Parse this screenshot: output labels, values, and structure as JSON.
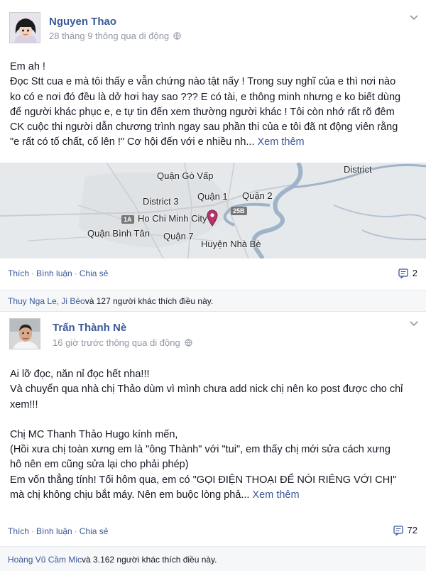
{
  "post1": {
    "author": "Nguyen Thao",
    "meta": "28 tháng 9 thông qua di động",
    "lines": [
      "Em ah !",
      "Đọc Stt cua e mà tôi thấy e vẫn chứng nào tật nấy ! Trong suy nghĩ của e thì nơi nào",
      "ko có e nơi đó đều là dở hơi hay sao ??? E có tài, e thông minh nhưng e ko biết dùng",
      "để người khác phục e, e tự tin đến xem thường người khác ! Tôi còn nhớ rất rõ đêm",
      "CK cuộc thi người dẫn chương trình ngay sau phần thi của e tôi đã nt động viên rằng",
      "\"e rất có tố chất, cố lên !\" Cơ hội đến với e nhiều nh..."
    ],
    "see_more": "Xem thêm",
    "map": {
      "labels": {
        "district": "District",
        "go_vap": "Quận Gò Vấp",
        "district3": "District 3",
        "q1": "Quận 1",
        "q2": "Quận 2",
        "hcmc": "Ho Chi Minh City",
        "binh_tan": "Quận Bình Tân",
        "q7": "Quận 7",
        "nha_be": "Huyện Nhà Bè",
        "shield_1a": "1A",
        "shield_25b": "25B"
      }
    },
    "actions": {
      "like": "Thích",
      "comment": "Bình luận",
      "share": "Chia sẻ"
    },
    "comment_count": "2",
    "likes": {
      "names": "Thuy Nga Le, Ji Béo",
      "rest": " và 127 người khác thích điều này."
    }
  },
  "post2": {
    "author": "Trấn Thành Nè",
    "meta": "16 giờ trước thông qua di động",
    "lines": [
      "Ai lỡ đọc, năn nỉ đọc hết nha!!!",
      "Và chuyển qua nhà chị Thảo dùm vì mình chưa add nick chị nên ko post được cho chỉ",
      "xem!!!",
      "",
      "Chị MC Thanh Thảo Hugo kính mến,",
      "(Hồi xưa chị toàn xưng em là \"ông Thành\" với \"tui\", em thấy chị mới sửa cách xưng",
      "hô nên em cũng sửa lại cho phải phép)",
      "Em vốn thẳng tính! Tối hôm qua, em có \"GỌI ĐIỆN THOẠI ĐỂ NÓI RIÊNG VỚI CHỊ\"",
      "mà chị không chịu bắt máy. Nên em buộc lòng phả..."
    ],
    "see_more": "Xem thêm",
    "actions": {
      "like": "Thích",
      "comment": "Bình luận",
      "share": "Chia sẻ"
    },
    "comment_count": "72",
    "likes": {
      "names": "Hoàng Vũ Cầm Mic",
      "rest": " và 3.162 người khác thích điều này."
    }
  },
  "icons": {
    "globe": "globe-icon",
    "chevron": "chevron-down-icon",
    "comment": "comment-icon",
    "map_pin": "map-pin-icon"
  },
  "colors": {
    "link": "#3b5998",
    "meta": "#9197a3",
    "pin": "#b5356b",
    "river": "#9fb4c8"
  }
}
